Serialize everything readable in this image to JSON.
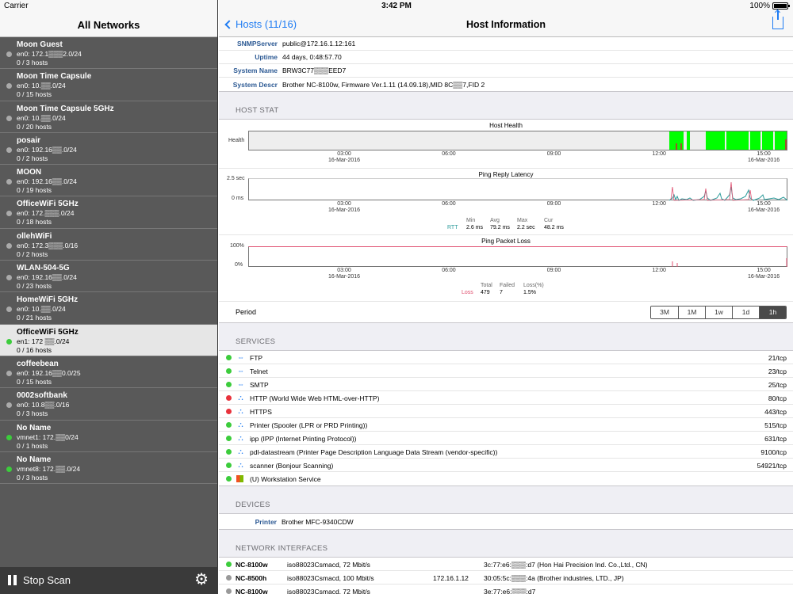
{
  "status_bar": {
    "carrier": "Carrier",
    "time": "3:42 PM",
    "battery": "100%"
  },
  "left": {
    "title": "All Networks",
    "networks": [
      {
        "name": "Moon Guest",
        "subnet": "en0: 172.1▒▒▒2.0/24",
        "hosts": "0 / 3 hosts",
        "status": "gray"
      },
      {
        "name": "Moon Time Capsule",
        "subnet": "en0: 10.▒▒.0/24",
        "hosts": "0 / 15 hosts",
        "status": "gray"
      },
      {
        "name": "Moon Time Capsule 5GHz",
        "subnet": "en0: 10.▒▒.0/24",
        "hosts": "0 / 20 hosts",
        "status": "gray"
      },
      {
        "name": "posair",
        "subnet": "en0: 192.16▒▒.0/24",
        "hosts": "0 / 2 hosts",
        "status": "gray"
      },
      {
        "name": "MOON",
        "subnet": "en0: 192.16▒▒.0/24",
        "hosts": "0 / 19 hosts",
        "status": "gray"
      },
      {
        "name": "OfficeWiFi 5GHz",
        "subnet": "en0: 172.▒▒▒.0/24",
        "hosts": "0 / 18 hosts",
        "status": "gray"
      },
      {
        "name": "ollehWiFi",
        "subnet": "en0: 172.3▒▒▒.0/16",
        "hosts": "0 / 2 hosts",
        "status": "gray"
      },
      {
        "name": "WLAN-504-5G",
        "subnet": "en0: 192.16▒▒.0/24",
        "hosts": "0 / 23 hosts",
        "status": "gray"
      },
      {
        "name": "HomeWiFi 5GHz",
        "subnet": "en0: 10.▒▒.0/24",
        "hosts": "0 / 21 hosts",
        "status": "gray"
      },
      {
        "name": "OfficeWiFi 5GHz",
        "subnet": "en1: 172 ▒▒.0/24",
        "hosts": "0 / 16 hosts",
        "status": "green",
        "selected": true
      },
      {
        "name": "coffeebean",
        "subnet": "en0: 192.16▒▒0.0/25",
        "hosts": "0 / 15 hosts",
        "status": "gray"
      },
      {
        "name": "0002softbank",
        "subnet": "en0: 10.8▒▒.0/16",
        "hosts": "0 / 3 hosts",
        "status": "gray"
      },
      {
        "name": "No Name",
        "subnet": "vmnet1: 172.▒▒0/24",
        "hosts": "0 / 1 hosts",
        "status": "green"
      },
      {
        "name": "No Name",
        "subnet": "vmnet8: 172.▒▒.0/24",
        "hosts": "0 / 3 hosts",
        "status": "green"
      }
    ],
    "footer": {
      "stop_label": "Stop Scan",
      "gear_icon": "gear-icon"
    }
  },
  "header": {
    "back_label": "Hosts (11/16)",
    "title": "Host Information",
    "share_icon": "share-icon"
  },
  "info": [
    {
      "key": "SNMPServer",
      "value": "public@172.16.1.12:161"
    },
    {
      "key": "Uptime",
      "value": "44 days, 0:48:57.70"
    },
    {
      "key": "System Name",
      "value": "BRW3C77▒▒▒EED7"
    },
    {
      "key": "System Descr",
      "value": "Brother NC-8100w, Firmware Ver.1.11  (14.09.18),MID 8C▒▒7,FID 2"
    }
  ],
  "host_stat": {
    "section_title": "HOST STAT",
    "x_ticks": [
      {
        "time": "03:00",
        "date": "16-Mar-2016"
      },
      {
        "time": "06:00",
        "date": ""
      },
      {
        "time": "09:00",
        "date": ""
      },
      {
        "time": "12:00",
        "date": ""
      },
      {
        "time": "15:00",
        "date": "16-Mar-2016"
      }
    ],
    "health": {
      "title": "Host Health",
      "ylabel": "Health"
    },
    "latency": {
      "title": "Ping Reply Latency",
      "y_top": "2.5 sec",
      "y_bottom": "0 ms",
      "stats_headers": [
        "Min",
        "Avg",
        "Max",
        "Cur"
      ],
      "stats_label": "RTT",
      "stats_values": [
        "2.6 ms",
        "79.2 ms",
        "2.2 sec",
        "48.2 ms"
      ]
    },
    "loss": {
      "title": "Ping Packet Loss",
      "y_top": "100%",
      "y_bottom": "0%",
      "stats_headers": [
        "Total",
        "Failed",
        "Loss(%)"
      ],
      "stats_label": "Loss",
      "stats_values": [
        "479",
        "7",
        "1.5%"
      ]
    },
    "period": {
      "label": "Period",
      "options": [
        "3M",
        "1M",
        "1w",
        "1d",
        "1h"
      ],
      "selected": "1h"
    }
  },
  "services": {
    "section_title": "SERVICES",
    "items": [
      {
        "name": "FTP",
        "port": "21/tcp",
        "status": "green",
        "icon": "arrows-icon"
      },
      {
        "name": "Telnet",
        "port": "23/tcp",
        "status": "green",
        "icon": "arrows-icon"
      },
      {
        "name": "SMTP",
        "port": "25/tcp",
        "status": "green",
        "icon": "arrows-icon"
      },
      {
        "name": "HTTP (World Wide Web HTML-over-HTTP)",
        "port": "80/tcp",
        "status": "red",
        "icon": "network-icon"
      },
      {
        "name": "HTTPS",
        "port": "443/tcp",
        "status": "red",
        "icon": "network-icon"
      },
      {
        "name": "Printer (Spooler (LPR or PRD Printing))",
        "port": "515/tcp",
        "status": "green",
        "icon": "network-icon"
      },
      {
        "name": "ipp (IPP (Internet Printing Protocol))",
        "port": "631/tcp",
        "status": "green",
        "icon": "network-icon"
      },
      {
        "name": "pdl-datastream (Printer Page Description Language Data Stream (vendor-specific))",
        "port": "9100/tcp",
        "status": "green",
        "icon": "network-icon"
      },
      {
        "name": "scanner (Bonjour Scanning)",
        "port": "54921/tcp",
        "status": "green",
        "icon": "network-icon"
      },
      {
        "name": "(U) Workstation Service",
        "port": "",
        "status": "green",
        "icon": "windows-icon"
      }
    ]
  },
  "devices": {
    "section_title": "DEVICES",
    "items": [
      {
        "key": "Printer",
        "value": "Brother MFC-9340CDW"
      }
    ]
  },
  "interfaces": {
    "section_title": "NETWORK INTERFACES",
    "items": [
      {
        "name": "NC-8100w",
        "type": "iso88023Csmacd, 72 Mbit/s",
        "ip": "",
        "mac": "3c:77:e6:▒▒▒:d7 (Hon Hai Precision Ind. Co.,Ltd., CN)",
        "status": "green"
      },
      {
        "name": "NC-8500h",
        "type": "iso88023Csmacd, 100 Mbit/s",
        "ip": "172.16.1.12",
        "mac": "30:05:5c:▒▒▒:4a (Brother industries, LTD., JP)",
        "status": "gray"
      },
      {
        "name": "NC-8100w",
        "type": "iso88023Csmacd, 72 Mbit/s",
        "ip": "",
        "mac": "3e:77:e6:▒▒▒:d7",
        "status": "gray"
      }
    ]
  },
  "colors": {
    "accent": "#1f7cf3",
    "ok": "#3ccc3c",
    "error": "#e8323c",
    "health_ok": "#00ff00",
    "latency": "#2a9a9a",
    "loss": "#e05070"
  }
}
